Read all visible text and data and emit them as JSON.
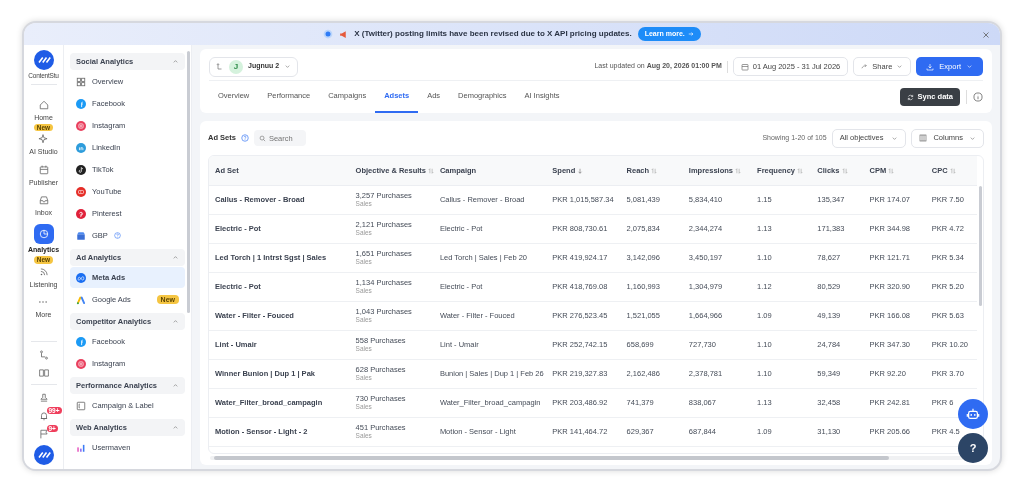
{
  "banner": {
    "text": "X (Twitter) posting limits have been revised due to X API pricing updates.",
    "button": "Learn more."
  },
  "rail": {
    "brand": "ContentStu",
    "items": [
      {
        "kind": "home",
        "label": "Home",
        "selected": false
      },
      {
        "kind": "sparkle",
        "label": "AI Studio",
        "selected": false,
        "badge": "New"
      },
      {
        "kind": "calendar",
        "label": "Publisher",
        "selected": false
      },
      {
        "kind": "inbox",
        "label": "Inbox",
        "selected": false
      },
      {
        "kind": "analytics",
        "label": "Analytics",
        "selected": true
      },
      {
        "kind": "rss",
        "label": "Listening",
        "selected": false,
        "badge": "New"
      },
      {
        "kind": "more",
        "label": "More",
        "selected": false
      }
    ],
    "bottom": [
      {
        "kind": "route"
      },
      {
        "kind": "book"
      },
      {
        "kind": "stamp"
      },
      {
        "kind": "bell",
        "badge": "99+"
      },
      {
        "kind": "flag",
        "badge": "9+"
      },
      {
        "kind": "logo"
      }
    ]
  },
  "sidebar": [
    {
      "title": "Social Analytics",
      "expanded": true,
      "items": [
        {
          "kind": "overview",
          "label": "Overview",
          "selected": false
        },
        {
          "kind": "facebook",
          "label": "Facebook",
          "selected": false
        },
        {
          "kind": "instagram",
          "label": "Instagram",
          "selected": false
        },
        {
          "kind": "linkedin",
          "label": "LinkedIn",
          "selected": false
        },
        {
          "kind": "tiktok",
          "label": "TikTok",
          "selected": false
        },
        {
          "kind": "youtube",
          "label": "YouTube",
          "selected": false
        },
        {
          "kind": "pinterest",
          "label": "Pinterest",
          "selected": false
        },
        {
          "kind": "gbp",
          "label": "GBP",
          "selected": false,
          "help": true
        }
      ]
    },
    {
      "title": "Ad Analytics",
      "expanded": true,
      "items": [
        {
          "kind": "meta",
          "label": "Meta Ads",
          "selected": true
        },
        {
          "kind": "google",
          "label": "Google Ads",
          "selected": false,
          "badge": "New"
        }
      ]
    },
    {
      "title": "Competitor Analytics",
      "expanded": true,
      "items": [
        {
          "kind": "facebook",
          "label": "Facebook",
          "selected": false
        },
        {
          "kind": "instagram",
          "label": "Instagram",
          "selected": false
        }
      ]
    },
    {
      "title": "Performance Analytics",
      "expanded": true,
      "items": [
        {
          "kind": "campaign",
          "label": "Campaign & Label",
          "selected": false
        }
      ]
    },
    {
      "title": "Web Analytics",
      "expanded": true,
      "items": [
        {
          "kind": "usermaven",
          "label": "Usermaven",
          "selected": false
        }
      ]
    }
  ],
  "header": {
    "account": {
      "initial": "J",
      "name": "Jugnuu 2"
    },
    "last_updated": "Last updated on **Aug 20, 2026 01:00 PM**",
    "date_range": "01 Aug 2025 - 31 Jul 2026",
    "share": "Share",
    "export": "Export",
    "sync": "Sync data",
    "tabs": [
      {
        "label": "Overview",
        "selected": false
      },
      {
        "label": "Performance",
        "selected": false
      },
      {
        "label": "Campaigns",
        "selected": false
      },
      {
        "label": "Adsets",
        "selected": true
      },
      {
        "label": "Ads",
        "selected": false
      },
      {
        "label": "Demographics",
        "selected": false
      },
      {
        "label": "AI Insights",
        "selected": false
      }
    ]
  },
  "table": {
    "title": "Ad Sets",
    "search": {
      "placeholder": "Search"
    },
    "showing": "Showing 1-20 of 105",
    "filter": "All objectives",
    "columns_button": "Columns",
    "columns": [
      {
        "label": "Ad Set",
        "sortable": false,
        "sorted": false
      },
      {
        "label": "Objective & Results",
        "sortable": true,
        "sorted": false
      },
      {
        "label": "Campaign",
        "sortable": false,
        "sorted": false
      },
      {
        "label": "Spend",
        "sortable": true,
        "sorted": true
      },
      {
        "label": "Reach",
        "sortable": true,
        "sorted": false
      },
      {
        "label": "Impressions",
        "sortable": true,
        "sorted": false
      },
      {
        "label": "Frequency",
        "sortable": true,
        "sorted": false
      },
      {
        "label": "Clicks",
        "sortable": true,
        "sorted": false
      },
      {
        "label": "CPM",
        "sortable": true,
        "sorted": false
      },
      {
        "label": "CPC",
        "sortable": true,
        "sorted": false
      }
    ],
    "rows": [
      {
        "ad_set": "Callus - Remover - Broad",
        "results": "3,257 Purchases",
        "objective": "Sales",
        "campaign": "Callus - Remover - Broad",
        "spend": "PKR 1,015,587.34",
        "reach": "5,081,439",
        "impressions": "5,834,410",
        "frequency": "1.15",
        "clicks": "135,347",
        "cpm": "PKR 174.07",
        "cpc": "PKR 7.50"
      },
      {
        "ad_set": "Electric - Pot",
        "results": "2,121 Purchases",
        "objective": "Sales",
        "campaign": "Electric - Pot",
        "spend": "PKR 808,730.61",
        "reach": "2,075,834",
        "impressions": "2,344,274",
        "frequency": "1.13",
        "clicks": "171,383",
        "cpm": "PKR 344.98",
        "cpc": "PKR 4.72"
      },
      {
        "ad_set": "Led Torch | 1 Intrst Sgst | Sales",
        "results": "1,651 Purchases",
        "objective": "Sales",
        "campaign": "Led Torch | Sales | Feb 20",
        "spend": "PKR 419,924.17",
        "reach": "3,142,096",
        "impressions": "3,450,197",
        "frequency": "1.10",
        "clicks": "78,627",
        "cpm": "PKR 121.71",
        "cpc": "PKR 5.34"
      },
      {
        "ad_set": "Electric - Pot",
        "results": "1,134 Purchases",
        "objective": "Sales",
        "campaign": "Electric - Pot",
        "spend": "PKR 418,769.08",
        "reach": "1,160,993",
        "impressions": "1,304,979",
        "frequency": "1.12",
        "clicks": "80,529",
        "cpm": "PKR 320.90",
        "cpc": "PKR 5.20"
      },
      {
        "ad_set": "Water - Filter - Fouced",
        "results": "1,043 Purchases",
        "objective": "Sales",
        "campaign": "Water - Filter - Fouced",
        "spend": "PKR 276,523.45",
        "reach": "1,521,055",
        "impressions": "1,664,966",
        "frequency": "1.09",
        "clicks": "49,139",
        "cpm": "PKR 166.08",
        "cpc": "PKR 5.63"
      },
      {
        "ad_set": "Lint - Umair",
        "results": "558 Purchases",
        "objective": "Sales",
        "campaign": "Lint - Umair",
        "spend": "PKR 252,742.15",
        "reach": "658,699",
        "impressions": "727,730",
        "frequency": "1.10",
        "clicks": "24,784",
        "cpm": "PKR 347.30",
        "cpc": "PKR 10.20"
      },
      {
        "ad_set": "Winner Bunion | Dup 1 | Pak",
        "results": "628 Purchases",
        "objective": "Sales",
        "campaign": "Bunion | Sales | Dup 1 | Feb 26",
        "spend": "PKR 219,327.83",
        "reach": "2,162,486",
        "impressions": "2,378,781",
        "frequency": "1.10",
        "clicks": "59,349",
        "cpm": "PKR 92.20",
        "cpc": "PKR 3.70"
      },
      {
        "ad_set": "Water_Filter_broad_campagin",
        "results": "730 Purchases",
        "objective": "Sales",
        "campaign": "Water_Filter_broad_campagin",
        "spend": "PKR 203,486.92",
        "reach": "741,379",
        "impressions": "838,067",
        "frequency": "1.13",
        "clicks": "32,458",
        "cpm": "PKR 242.81",
        "cpc": "PKR 6"
      },
      {
        "ad_set": "Motion - Sensor - Light - 2",
        "results": "451 Purchases",
        "objective": "Sales",
        "campaign": "Motion - Sensor - Light",
        "spend": "PKR 141,464.72",
        "reach": "629,367",
        "impressions": "687,844",
        "frequency": "1.09",
        "clicks": "31,130",
        "cpm": "PKR 205.66",
        "cpc": "PKR 4.5"
      }
    ]
  },
  "floating": {
    "help": "?"
  }
}
